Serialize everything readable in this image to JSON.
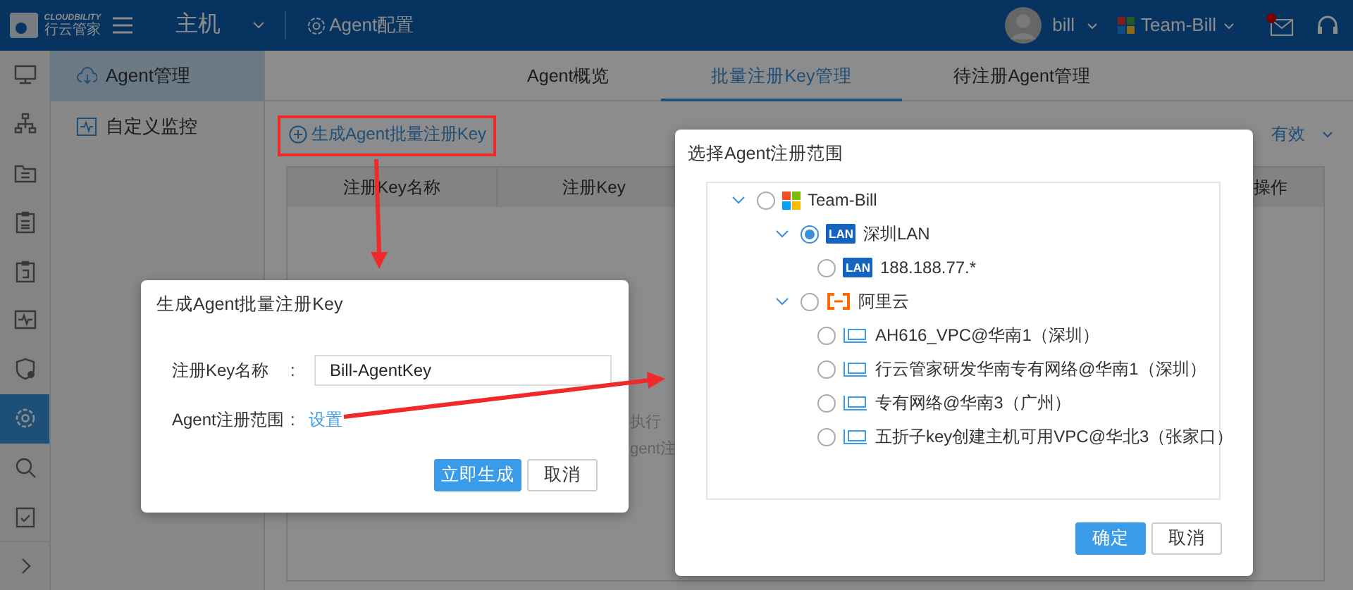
{
  "header": {
    "logo_text": "CLOUDBILITY",
    "logo_subtext": "行云管家",
    "module": "主机",
    "page": "Agent配置",
    "user": "bill",
    "team": "Team-Bill",
    "mail_unread": true
  },
  "rail": [
    {
      "selected": false
    },
    {
      "selected": false
    },
    {
      "selected": false
    },
    {
      "selected": false
    },
    {
      "selected": false
    },
    {
      "selected": false
    },
    {
      "selected": false
    },
    {
      "selected": true
    },
    {
      "selected": false
    },
    {
      "selected": false
    },
    {
      "selected": false
    }
  ],
  "sidebar": {
    "items": [
      {
        "label": "Agent管理",
        "selected": true
      },
      {
        "label": "自定义监控",
        "selected": false
      }
    ]
  },
  "tabs": [
    {
      "label": "Agent概览",
      "selected": false
    },
    {
      "label": "批量注册Key管理",
      "selected": true
    },
    {
      "label": "待注册Agent管理",
      "selected": false
    }
  ],
  "toolbar": {
    "create_link": "生成Agent批量注册Key",
    "filter": "有效"
  },
  "table": {
    "columns": [
      "注册Key名称",
      "注册Key",
      "操作"
    ],
    "empty_text": [
      "执行",
      "gent注"
    ]
  },
  "generate_dialog": {
    "title": "生成Agent批量注册Key",
    "fields": [
      {
        "label": "注册Key名称",
        "separator": ":",
        "kind": "input",
        "value": "Bill-AgentKey"
      },
      {
        "label": "Agent注册范围",
        "separator": ":",
        "kind": "link",
        "value": "设置"
      }
    ],
    "buttons": [
      {
        "label": "立即生成",
        "primary": true
      },
      {
        "label": "取消",
        "primary": false
      }
    ]
  },
  "scope_dialog": {
    "title": "选择Agent注册范围",
    "tree": [
      {
        "label": "Team-Bill",
        "kind": "team",
        "selected": false,
        "expanded": true,
        "children": [
          {
            "label": "深圳LAN",
            "kind": "lan",
            "icon_text": "LAN",
            "selected": true,
            "expanded": true,
            "children": [
              {
                "label": "188.188.77.*",
                "kind": "lan",
                "icon_text": "LAN",
                "selected": false
              }
            ]
          },
          {
            "label": "阿里云",
            "kind": "aliyun",
            "selected": false,
            "expanded": true,
            "children": [
              {
                "label": "AH616_VPC@华南1（深圳）",
                "kind": "vpc",
                "selected": false
              },
              {
                "label": "行云管家研发华南专有网络@华南1（深圳）",
                "kind": "vpc",
                "selected": false
              },
              {
                "label": "专有网络@华南3（广州）",
                "kind": "vpc",
                "selected": false
              },
              {
                "label": "五折子key创建主机可用VPC@华北3（张家口）",
                "kind": "vpc",
                "selected": false
              }
            ]
          }
        ]
      }
    ],
    "buttons": [
      {
        "label": "确定",
        "primary": true
      },
      {
        "label": "取消",
        "primary": false
      }
    ]
  }
}
